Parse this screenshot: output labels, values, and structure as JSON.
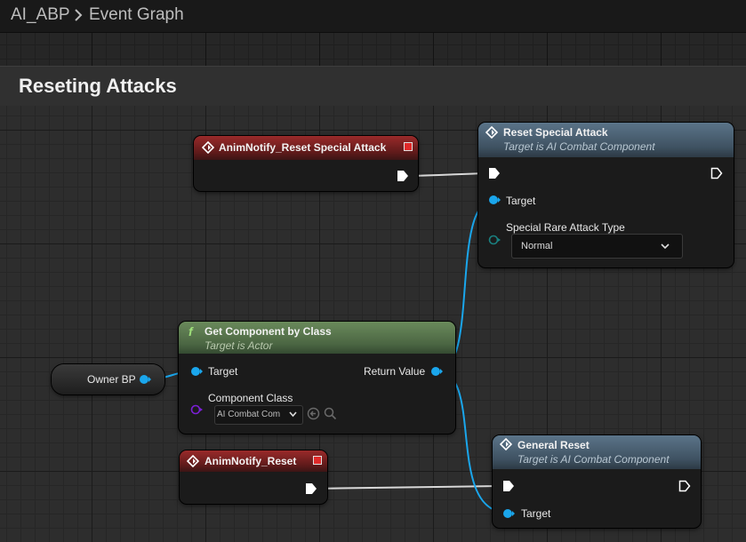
{
  "breadcrumb": {
    "root": "AI_ABP",
    "current": "Event Graph"
  },
  "comment": {
    "title": "Reseting Attacks"
  },
  "nodes": {
    "anim_notify_special": {
      "title": "AnimNotify_Reset Special Attack"
    },
    "reset_special": {
      "title": "Reset Special Attack",
      "subtitle": "Target is AI Combat Component",
      "target_label": "Target",
      "type_label": "Special Rare Attack Type",
      "type_value": "Normal"
    },
    "get_component": {
      "title": "Get Component by Class",
      "subtitle": "Target is Actor",
      "target_label": "Target",
      "return_label": "Return Value",
      "class_label": "Component Class",
      "class_value": "AI Combat Com"
    },
    "owner": {
      "label": "Owner BP"
    },
    "anim_notify_reset": {
      "title": "AnimNotify_Reset"
    },
    "general_reset": {
      "title": "General Reset",
      "subtitle": "Target is AI Combat Component",
      "target_label": "Target"
    }
  },
  "colors": {
    "object_pin": "#1aa6ec",
    "class_pin": "#7b1fd6",
    "enum_pin": "#1a6e6e",
    "exec_pin": "#ffffff",
    "event_header": "#8b2525",
    "function_header": "#4a5f70",
    "pure_header": "#5a7a4d"
  },
  "icons": [
    "diamond-event-icon",
    "function-f-icon",
    "chevron-right-icon",
    "chevron-down-icon",
    "arrow-left-circle-icon",
    "magnifier-icon"
  ]
}
